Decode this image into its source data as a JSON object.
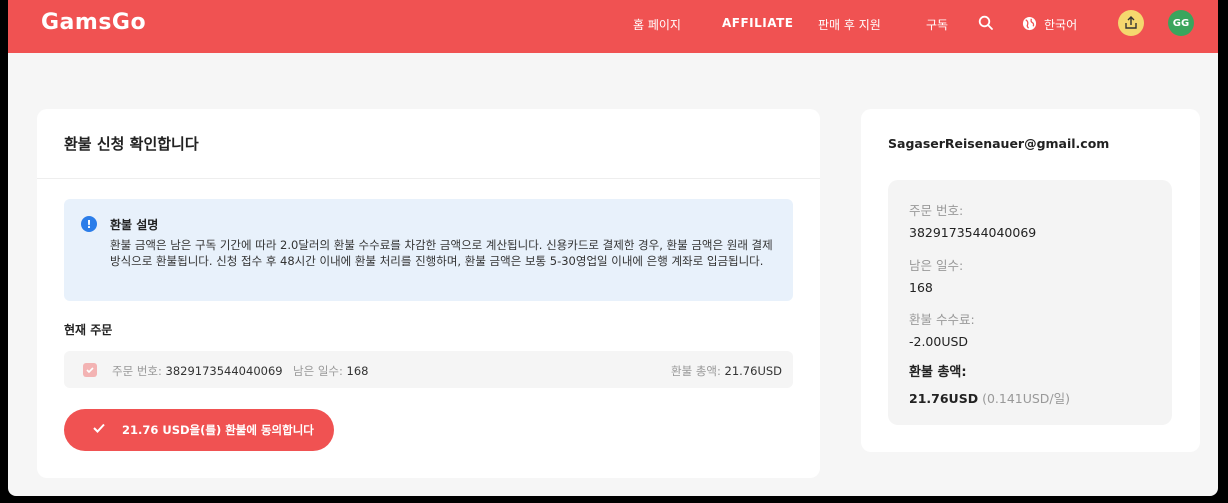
{
  "nav": {
    "logo": "GamsGo",
    "items": [
      "홈 페이지",
      "AFFILIATE",
      "판매 후 지원",
      "구독"
    ],
    "language": "한국어",
    "avatar": "GG",
    "accent": "#f05252"
  },
  "main": {
    "title": "환불 신청 확인합니다",
    "notice": {
      "title": "환불 설명",
      "body": "환불 금액은 남은 구독 기간에 따라 2.0달러의 환불 수수료를 차감한 금액으로 계산됩니다. 신용카드로 결제한 경우, 환불 금액은 원래 결제 방식으로 환불됩니다. 신청 접수 후 48시간 이내에 환불 처리를 진행하며, 환불 금액은 보통 5-30영업일 이내에 은행 계좌로 입금됩니다."
    },
    "current_order_label": "현재 주문",
    "order": {
      "order_no_label": "주문 번호:",
      "order_no": "3829173544040069",
      "days_label": "남은 일수:",
      "days": "168",
      "total_label": "환불 총액:",
      "total": "21.76USD"
    },
    "agree_button": "21.76 USD을(를) 환불에 동의합니다"
  },
  "summary": {
    "email": "SagaserReisenauer@gmail.com",
    "order_no_label": "주문 번호:",
    "order_no": "3829173544040069",
    "days_label": "남은 일수:",
    "days": "168",
    "fee_label": "환불 수수료:",
    "fee": "-2.00USD",
    "total_label": "환불 총액:",
    "total": "21.76USD",
    "total_sub": "(0.141USD/일)"
  }
}
